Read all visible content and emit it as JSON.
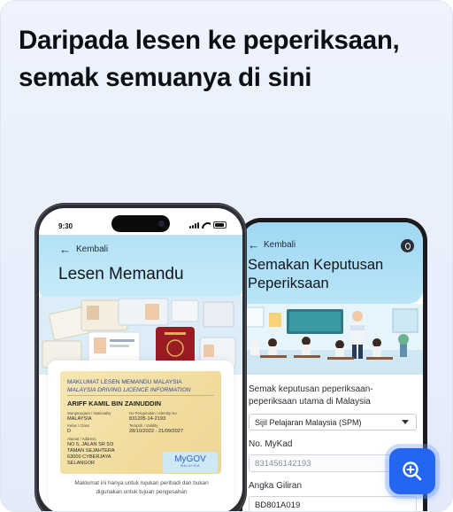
{
  "headline": "Daripada lesen ke peperiksaan, semak semuanya di sini",
  "colors": {
    "accent": "#2566f0",
    "card_bg": "#eef3fd",
    "header_blue": "#b3e2f6"
  },
  "phone_front": {
    "status_time": "9:30",
    "back_label": "Kembali",
    "title": "Lesen Memandu",
    "license": {
      "title_ms": "MAKLUMAT LESEN MEMANDU MALAYSIA",
      "title_en": "MALAYSIA DRIVING LICENCE INFORMATION",
      "name": "ARIFF KAMIL BIN ZAINUDDIN",
      "nationality_label": "Warganegara / Nationality",
      "nationality": "MALAYSIA",
      "id_label": "No Pengenalan / Identity No",
      "id_no": "831205-14-2193",
      "class_label": "Kelas / Class",
      "class": "D",
      "validity_label": "Tempoh / Validity",
      "validity": "28/10/2022 - 21/09/2027",
      "address_label": "Alamat / Address",
      "address_1": "NO 5, JALAN SR 5/3",
      "address_2": "TAMAN SEJAHTERA",
      "address_3": "63000 CYBERJAYA",
      "address_4": "SELANGOR",
      "logo_main": "MyGOV",
      "logo_sub": "MALAYSIA"
    },
    "note": "Maklumat ini hanya untuk rujukan peribadi dan bukan digunakan untuk tujuan pengesahan"
  },
  "phone_back": {
    "back_label": "Kembali",
    "title": "Semakan Keputusan Peperiksaan",
    "question": "Semak keputusan peperiksaan-peperiksaan utama di Malaysia",
    "select_value": "Sijil Pelajaran Malaysia (SPM)",
    "mykad_label": "No. MyKad",
    "mykad_value": "831456142193",
    "angka_label": "Angka Giliran",
    "angka_value": "BD801A019"
  },
  "fab": {
    "icon": "zoom-in-icon"
  }
}
